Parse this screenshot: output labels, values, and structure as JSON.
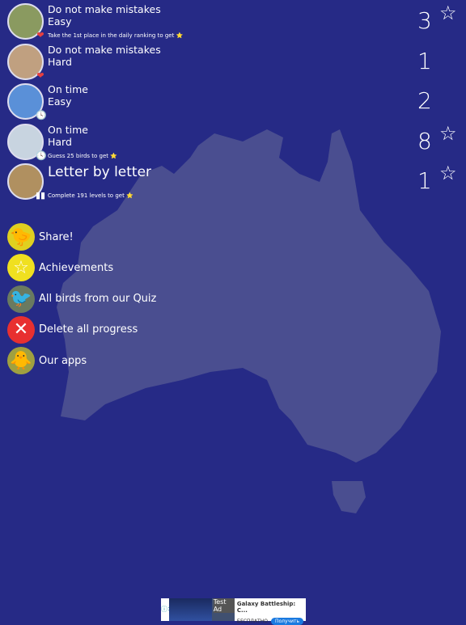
{
  "modes": [
    {
      "title": "Do not make mistakes",
      "level": "Easy",
      "hint": "Take the 1st place in the daily ranking to get ⭐",
      "badge": "heart-icon",
      "score": "3",
      "star": true,
      "color": "#8a9a60"
    },
    {
      "title": "Do not make mistakes",
      "level": "Hard",
      "hint": "",
      "badge": "heart-icon",
      "score": "1",
      "star": false,
      "color": "#c0a080"
    },
    {
      "title": "On time",
      "level": "Easy",
      "hint": "",
      "badge": "clock-icon",
      "score": "2",
      "star": false,
      "color": "#5a90d8"
    },
    {
      "title": "On time",
      "level": "Hard",
      "hint": "Guess 25 birds to get ⭐",
      "badge": "clock-icon",
      "score": "8",
      "star": true,
      "color": "#c8d4e0"
    },
    {
      "title": "Letter by letter",
      "level": "",
      "hint": "Complete 191 levels to get ⭐",
      "badge": "keyboard-icon",
      "score": "1",
      "star": true,
      "color": "#b09060"
    }
  ],
  "menu": [
    {
      "label": "Share!",
      "icon": "share-bird-icon",
      "bg": "#e0d020",
      "glyph": "🐤"
    },
    {
      "label": "Achievements",
      "icon": "star-icon",
      "bg": "#f0e020",
      "glyph": "☆"
    },
    {
      "label": "All birds from our Quiz",
      "icon": "birds-icon",
      "bg": "#6a7a60",
      "glyph": "🐦"
    },
    {
      "label": "Delete all progress",
      "icon": "delete-icon",
      "bg": "#e83030",
      "glyph": "✕"
    },
    {
      "label": "Our apps",
      "icon": "apps-icon",
      "bg": "#a0a040",
      "glyph": "🐥"
    }
  ],
  "ad": {
    "badge": "Test Ad",
    "title": "Galaxy Battleship: C...",
    "price": "БЕСПЛАТНО",
    "button": "Получить"
  },
  "colors": {
    "background": "#262a86",
    "map": "#4a4e90"
  }
}
